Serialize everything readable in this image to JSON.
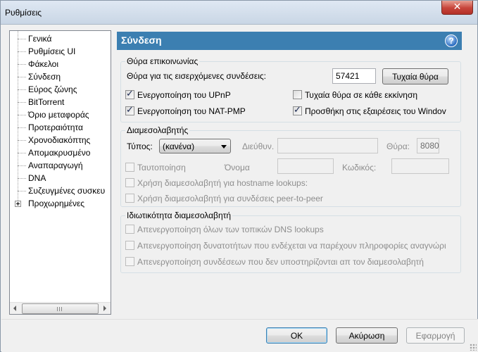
{
  "window": {
    "title": "Ρυθμίσεις"
  },
  "sidebar": {
    "items": [
      {
        "label": "Γενικά"
      },
      {
        "label": "Ρυθμίσεις UI"
      },
      {
        "label": "Φάκελοι"
      },
      {
        "label": "Σύνδεση"
      },
      {
        "label": "Εύρος ζώνης"
      },
      {
        "label": "BitTorrent"
      },
      {
        "label": "Όριο μεταφοράς"
      },
      {
        "label": "Προτεραιότητα"
      },
      {
        "label": "Χρονοδιακόπτης"
      },
      {
        "label": "Απομακρυσμένο"
      },
      {
        "label": "Αναπαραγωγή"
      },
      {
        "label": "DNA"
      },
      {
        "label": "Συζευγμένες συσκευ"
      },
      {
        "label": "Προχωρημένες"
      }
    ],
    "selected": "Σύνδεση"
  },
  "panel": {
    "title": "Σύνδεση",
    "help_icon_text": "?"
  },
  "listening_port": {
    "group_title": "Θύρα επικοινωνίας",
    "port_label": "Θύρα για τις εισερχόμενες συνδέσεις:",
    "port_value": "57421",
    "random_port_button": "Τυχαία θύρα",
    "upnp_label": "Ενεργοποίηση του UPnP",
    "upnp_checked": true,
    "random_each_start_label": "Τυχαία θύρα σε κάθε εκκίνηση",
    "random_each_start_checked": false,
    "natpmp_label": "Ενεργοποίηση του NAT-PMP",
    "natpmp_checked": true,
    "firewall_label": "Προσθήκη στις εξαιρέσεις του Windov",
    "firewall_checked": true
  },
  "proxy": {
    "group_title": "Διαμεσολαβητής",
    "type_label": "Τύπος:",
    "type_value": "(κανένα)",
    "address_label": "Διεύθυν.",
    "address_value": "",
    "port_label": "Θύρα:",
    "port_value": "8080",
    "auth_label": "Ταυτοποίηση",
    "username_label": "Όνομα",
    "username_value": "",
    "password_label": "Κωδικός:",
    "password_value": "",
    "hostname_lookup_label": "Χρήση διαμεσολαβητή για hostname lookups:",
    "peer_to_peer_label": "Χρήση διαμεσολαβητή για συνδέσεις peer-to-peer"
  },
  "privacy": {
    "group_title": "Ιδιωτικότητα διαμεσολαβητή",
    "option1": "Απενεργοποίηση όλων των τοπικών DNS lookups",
    "option2": "Απενεργοποίηση δυνατοτήτων που ενδέχεται να παρέχουν πληροφορίες αναγνώρι",
    "option3": "Απενεργοποίηση συνδέσεων που δεν υποστηρίζονται απ τον διαμεσολαβητή"
  },
  "buttons": {
    "ok": "OK",
    "cancel": "Ακύρωση",
    "apply": "Εφαρμογή"
  },
  "icons": {
    "close": "close-icon",
    "help": "help-icon",
    "expander": "plus-expander-icon"
  },
  "colors": {
    "header_bg": "#3c7fb1",
    "close_button": "#c7443a"
  }
}
